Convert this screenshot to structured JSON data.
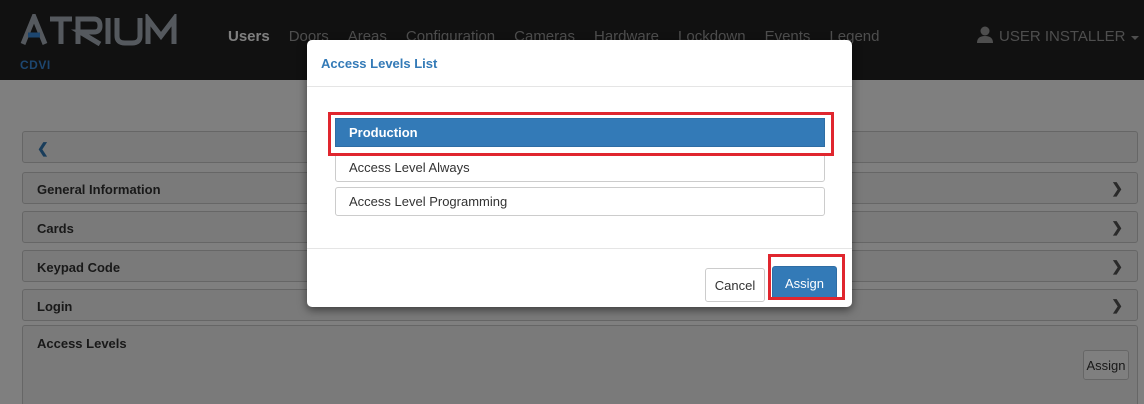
{
  "navbar": {
    "brand": "ATRIUM",
    "brand_sub": "CDVI",
    "items": [
      {
        "label": "Users",
        "active": true
      },
      {
        "label": "Doors",
        "active": false
      },
      {
        "label": "Areas",
        "active": false
      },
      {
        "label": "Configuration",
        "active": false
      },
      {
        "label": "Cameras",
        "active": false
      },
      {
        "label": "Hardware",
        "active": false
      },
      {
        "label": "Lockdown",
        "active": false
      },
      {
        "label": "Events",
        "active": false
      },
      {
        "label": "Legend",
        "active": false
      }
    ],
    "user": {
      "label": "USER INSTALLER",
      "icon": "user-icon"
    }
  },
  "page": {
    "back_icon": "chevron-left-icon",
    "sections": [
      {
        "label": "General Information",
        "icon": "chevron-right-icon"
      },
      {
        "label": "Cards",
        "icon": "chevron-right-icon"
      },
      {
        "label": "Keypad Code",
        "icon": "chevron-right-icon"
      },
      {
        "label": "Login",
        "icon": "chevron-right-icon"
      }
    ],
    "access_levels": {
      "label": "Access Levels",
      "assign_button": "Assign"
    }
  },
  "modal": {
    "title": "Access Levels List",
    "items": [
      {
        "label": "Production",
        "selected": true
      },
      {
        "label": "Access Level Always",
        "selected": false
      },
      {
        "label": "Access Level Programming",
        "selected": false
      }
    ],
    "cancel_button": "Cancel",
    "assign_button": "Assign"
  },
  "colors": {
    "navbar_bg": "#222222",
    "brand_accent": "#3a8dde",
    "primary": "#337ab7",
    "highlight": "#e0262e"
  }
}
